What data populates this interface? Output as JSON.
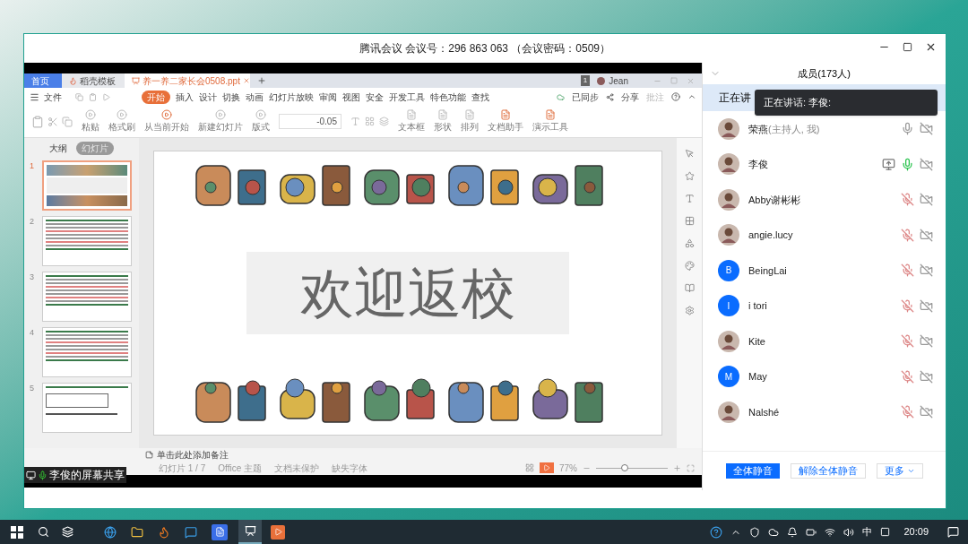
{
  "window": {
    "title": "腾讯会议 会议号：296 863 063 （会议密码：0509）"
  },
  "shared_screen": {
    "label": "李俊的屏幕共享",
    "wps": {
      "tabs": [
        {
          "label": "首页",
          "kind": "home",
          "selected": false
        },
        {
          "label": "稻壳模板",
          "kind": "template",
          "selected": false
        },
        {
          "label": "养一养二家长会0508.ppt",
          "kind": "document",
          "selected": true
        }
      ],
      "user": {
        "badge": "1",
        "name": "Jean"
      },
      "menu": [
        {
          "label": "文件",
          "selected": false
        },
        {
          "label": "开始",
          "selected": true
        },
        {
          "label": "插入",
          "selected": false
        },
        {
          "label": "设计",
          "selected": false
        },
        {
          "label": "切换",
          "selected": false
        },
        {
          "label": "动画",
          "selected": false
        },
        {
          "label": "幻灯片放映",
          "selected": false
        },
        {
          "label": "审阅",
          "selected": false
        },
        {
          "label": "视图",
          "selected": false
        },
        {
          "label": "安全",
          "selected": false
        },
        {
          "label": "开发工具",
          "selected": false
        },
        {
          "label": "特色功能",
          "selected": false
        },
        {
          "label": "查找",
          "selected": false
        }
      ],
      "menu_right": [
        "已同步",
        "分享",
        "批注"
      ],
      "toolbar": [
        "粘贴",
        "格式刷",
        "从当前开始",
        "新建幻灯片",
        "版式"
      ],
      "font_size": "-0.05",
      "toolbar_right": [
        "文本框",
        "形状",
        "排列",
        "文档助手",
        "演示工具"
      ],
      "slide_tabs": [
        {
          "label": "大纲",
          "selected": false
        },
        {
          "label": "幻灯片",
          "selected": true
        }
      ],
      "slides": [
        {
          "number": "1",
          "kind": "title",
          "selected": true
        },
        {
          "number": "2",
          "kind": "text",
          "selected": false
        },
        {
          "number": "3",
          "kind": "text",
          "selected": false
        },
        {
          "number": "4",
          "kind": "text",
          "selected": false
        },
        {
          "number": "5",
          "kind": "table",
          "selected": false
        }
      ],
      "slide": {
        "title": "欢迎返校"
      },
      "notes_placeholder": "单击此处添加备注",
      "status": [
        "幻灯片 1 / 7",
        "Office 主题",
        "文档未保护",
        "缺失字体"
      ],
      "zoom": "77%",
      "zoom_slider": {
        "level": 0.4
      }
    }
  },
  "members_panel": {
    "title": "成员(173人)",
    "speaking_bar": "正在讲",
    "tooltip": "正在讲话: 李俊:",
    "members": [
      {
        "name": "荣燕",
        "note": "(主持人, 我)",
        "kind": "photo",
        "muted": false,
        "speaking": false,
        "sharing": false
      },
      {
        "name": "李俊",
        "kind": "photo",
        "muted": false,
        "speaking": true,
        "sharing": true
      },
      {
        "name": "Abby谢彬彬",
        "kind": "photo",
        "muted": true,
        "sharing": false
      },
      {
        "name": "angie.lucy",
        "kind": "photo",
        "muted": true,
        "sharing": false
      },
      {
        "name": "BeingLai",
        "kind": "letter",
        "letter": "B",
        "muted": true,
        "sharing": false
      },
      {
        "name": "i tori",
        "kind": "letter",
        "letter": "I",
        "muted": true,
        "sharing": false
      },
      {
        "name": "Kite",
        "kind": "photo",
        "muted": true,
        "sharing": false
      },
      {
        "name": "May",
        "kind": "letter",
        "letter": "M",
        "muted": true,
        "sharing": false
      },
      {
        "name": "Nalshé",
        "kind": "photo",
        "muted": true,
        "sharing": false
      }
    ],
    "buttons": [
      {
        "label": "全体静音",
        "kind": "primary"
      },
      {
        "label": "解除全体静音",
        "kind": "secondary"
      },
      {
        "label": "更多",
        "kind": "menu"
      }
    ]
  },
  "taskbar": {
    "ime": "中",
    "clock": "20:09"
  }
}
